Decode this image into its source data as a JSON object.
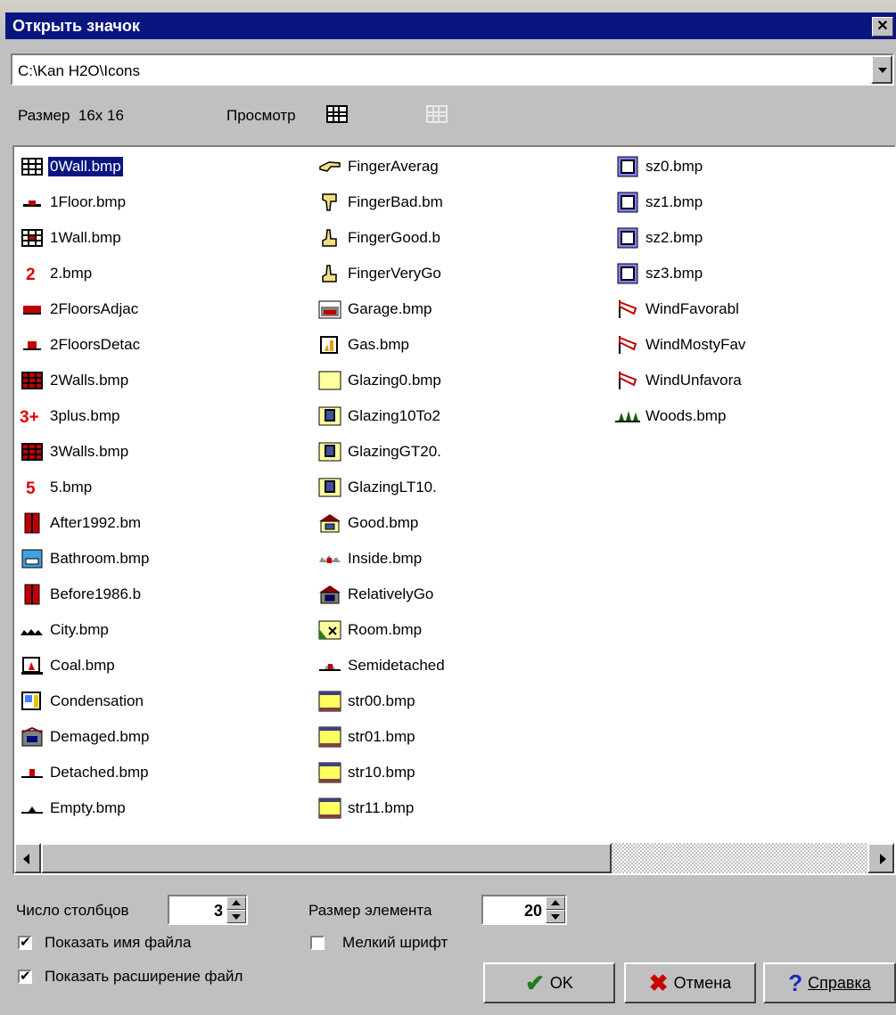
{
  "window": {
    "title": "Открыть значок",
    "close_label": "✕"
  },
  "path": {
    "value": "C:\\Kan H2O\\Icons"
  },
  "info": {
    "size_label": "Размер",
    "size_value": "16x 16",
    "view_label": "Просмотр"
  },
  "files": {
    "col1": [
      {
        "name": "0Wall.bmp",
        "icon": "wall-grid-icon",
        "selected": true
      },
      {
        "name": "1Floor.bmp",
        "icon": "floor-icon"
      },
      {
        "name": "1Wall.bmp",
        "icon": "wall-red-icon"
      },
      {
        "name": "2.bmp",
        "icon": "number-2-icon"
      },
      {
        "name": "2FloorsAdjac",
        "icon": "floors-adjacent-icon"
      },
      {
        "name": "2FloorsDetac",
        "icon": "floors-detached-icon"
      },
      {
        "name": "2Walls.bmp",
        "icon": "walls-icon"
      },
      {
        "name": "3plus.bmp",
        "icon": "three-plus-icon"
      },
      {
        "name": "3Walls.bmp",
        "icon": "walls-icon"
      },
      {
        "name": "5.bmp",
        "icon": "number-5-icon"
      },
      {
        "name": "After1992.bm",
        "icon": "door-icon"
      },
      {
        "name": "Bathroom.bmp",
        "icon": "bathroom-icon"
      },
      {
        "name": "Before1986.b",
        "icon": "door-icon"
      },
      {
        "name": "City.bmp",
        "icon": "city-icon"
      },
      {
        "name": "Coal.bmp",
        "icon": "coal-icon"
      },
      {
        "name": "Condensation",
        "icon": "condensation-icon"
      },
      {
        "name": "Demaged.bmp",
        "icon": "damaged-house-icon"
      },
      {
        "name": "Detached.bmp",
        "icon": "detached-house-icon"
      },
      {
        "name": "Empty.bmp",
        "icon": "empty-house-icon"
      }
    ],
    "col2": [
      {
        "name": "FingerAverag",
        "icon": "finger-average-icon"
      },
      {
        "name": "FingerBad.bm",
        "icon": "finger-bad-icon"
      },
      {
        "name": "FingerGood.b",
        "icon": "finger-good-icon"
      },
      {
        "name": "FingerVeryGo",
        "icon": "finger-very-good-icon"
      },
      {
        "name": "Garage.bmp",
        "icon": "garage-icon"
      },
      {
        "name": "Gas.bmp",
        "icon": "gas-icon"
      },
      {
        "name": "Glazing0.bmp",
        "icon": "glazing-empty-icon"
      },
      {
        "name": "Glazing10To2",
        "icon": "glazing-window-icon"
      },
      {
        "name": "GlazingGT20.",
        "icon": "glazing-window-icon"
      },
      {
        "name": "GlazingLT10.",
        "icon": "glazing-window-icon"
      },
      {
        "name": "Good.bmp",
        "icon": "good-house-icon"
      },
      {
        "name": "Inside.bmp",
        "icon": "inside-icon"
      },
      {
        "name": "RelativelyGo",
        "icon": "relatively-good-house-icon"
      },
      {
        "name": "Room.bmp",
        "icon": "room-icon"
      },
      {
        "name": "Semidetached",
        "icon": "semidetached-icon"
      },
      {
        "name": "str00.bmp",
        "icon": "stripe-icon"
      },
      {
        "name": "str01.bmp",
        "icon": "stripe-icon"
      },
      {
        "name": "str10.bmp",
        "icon": "stripe-icon"
      },
      {
        "name": "str11.bmp",
        "icon": "stripe-icon"
      }
    ],
    "col3": [
      {
        "name": "sz0.bmp",
        "icon": "size-frame-icon"
      },
      {
        "name": "sz1.bmp",
        "icon": "size-frame-icon"
      },
      {
        "name": "sz2.bmp",
        "icon": "size-frame-icon"
      },
      {
        "name": "sz3.bmp",
        "icon": "size-frame-icon"
      },
      {
        "name": "WindFavorabl",
        "icon": "windsock-icon"
      },
      {
        "name": "WindMostyFav",
        "icon": "windsock-icon"
      },
      {
        "name": "WindUnfavora",
        "icon": "windsock-icon"
      },
      {
        "name": "Woods.bmp",
        "icon": "woods-icon"
      }
    ]
  },
  "controls": {
    "columns_label": "Число столбцов",
    "columns_value": "3",
    "elem_size_label": "Размер элемента",
    "elem_size_value": "20",
    "show_name_label": "Показать имя файла",
    "show_name_checked": true,
    "small_font_label": "Мелкий шрифт",
    "small_font_checked": false,
    "show_ext_label": "Показать расширение файл",
    "show_ext_checked": true
  },
  "buttons": {
    "ok": "OK",
    "cancel": "Отмена",
    "help": "Справка"
  },
  "colors": {
    "title_bar": "#0a1680",
    "selection": "#0a1680",
    "face": "#c0c0c0"
  }
}
